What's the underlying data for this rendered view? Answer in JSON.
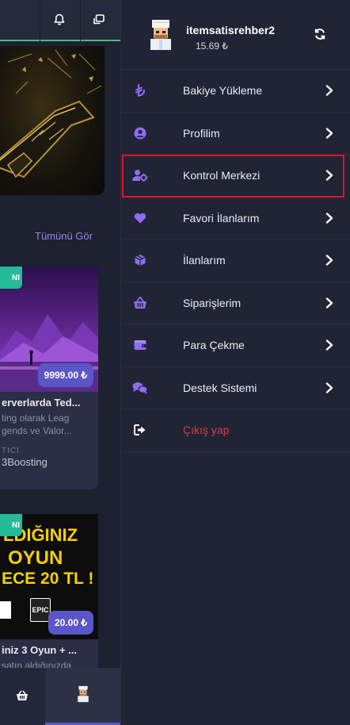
{
  "background_app": {
    "see_all_label": "Tümünü Gör",
    "cards": [
      {
        "badge": "NI",
        "price": "9999.00 ₺",
        "title": "erverlarda Ted...",
        "desc_line1": "ting olarak Leag",
        "desc_line2": "gends ve Valor...",
        "seller_label": "TICI",
        "seller": "3Boosting"
      },
      {
        "badge": "NI",
        "price": "20.00 ₺",
        "title": "iniz 3 Oyun + ...",
        "desc_line1": "satın aldığınızda",
        "image_text_line1": "LDIĞINIZ",
        "image_text_line2": "OYUN",
        "image_text_line3": "ECE 20 TL !",
        "image_text_epic": "EPIC"
      }
    ]
  },
  "drawer": {
    "username": "itemsatisrehber2",
    "balance": "15.69 ₺",
    "menu": [
      {
        "label": "Bakiye Yükleme",
        "icon": "lira-icon"
      },
      {
        "label": "Profilim",
        "icon": "user-circle-icon"
      },
      {
        "label": "Kontrol Merkezi",
        "icon": "user-cog-icon",
        "highlighted": true
      },
      {
        "label": "Favori İlanlarım",
        "icon": "heart-icon"
      },
      {
        "label": "İlanlarım",
        "icon": "box-icon"
      },
      {
        "label": "Siparişlerim",
        "icon": "basket-icon"
      },
      {
        "label": "Para Çekme",
        "icon": "wallet-icon"
      },
      {
        "label": "Destek Sistemi",
        "icon": "comments-icon"
      },
      {
        "label": "Çıkış yap",
        "icon": "sign-out-icon"
      }
    ]
  },
  "colors": {
    "accent": "#8f6cf0",
    "highlight_border": "#e0142b",
    "logout_text": "#e0384e",
    "drawer_bg": "#202434"
  }
}
